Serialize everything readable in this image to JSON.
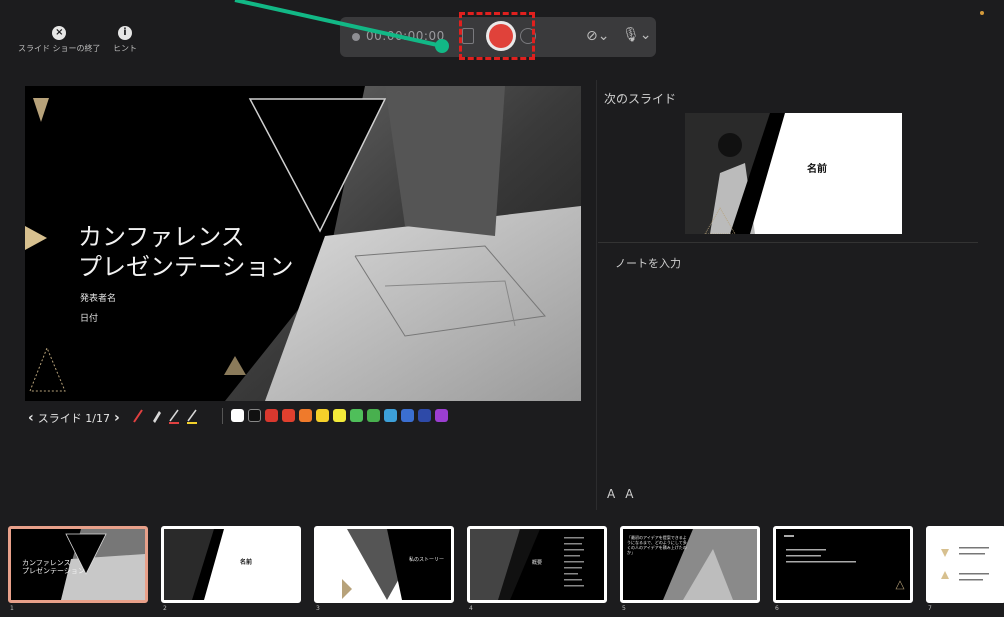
{
  "toolbar": {
    "end_show_label": "スライド ショーの終了",
    "hint_label": "ヒント",
    "timer": "00:00:00:00"
  },
  "slide": {
    "title": "カンファレンス\nプレゼンテーション",
    "presenter": "発表者名",
    "date": "日付",
    "counter": "スライド 1/17"
  },
  "next_slide": {
    "label": "次のスライド",
    "name": "名前"
  },
  "notes": {
    "placeholder": "ノートを入力"
  },
  "font_buttons": {
    "decrease": "A",
    "increase": "A"
  },
  "thumb_1": {
    "title": "カンファレンス\nプレゼンテーション"
  },
  "thumb_2": {
    "name": "名前"
  },
  "thumb_3": {
    "title": "私のストーリー"
  },
  "thumb_4": {
    "title": "概要"
  },
  "thumb_5": {
    "text": "「最初のアイデアを提案できるようになるまで、どのようにして多くの人のアイデアを積み上げたのか」"
  },
  "thumbnails": [
    {
      "num": "1"
    },
    {
      "num": "2"
    },
    {
      "num": "3"
    },
    {
      "num": "4"
    },
    {
      "num": "5"
    },
    {
      "num": "6"
    },
    {
      "num": "7"
    }
  ],
  "colors": {
    "swatches": [
      "#ffffff",
      "#111111",
      "#d9382e",
      "#e0402e",
      "#ef7a2b",
      "#f6d02a",
      "#f2ea3a",
      "#4fbf5a",
      "#48b04e",
      "#3da0d9",
      "#3b6fd1",
      "#2e4aa8",
      "#9b3ed1"
    ],
    "record": "#e0423a",
    "annotation_arrow": "#12b886"
  }
}
